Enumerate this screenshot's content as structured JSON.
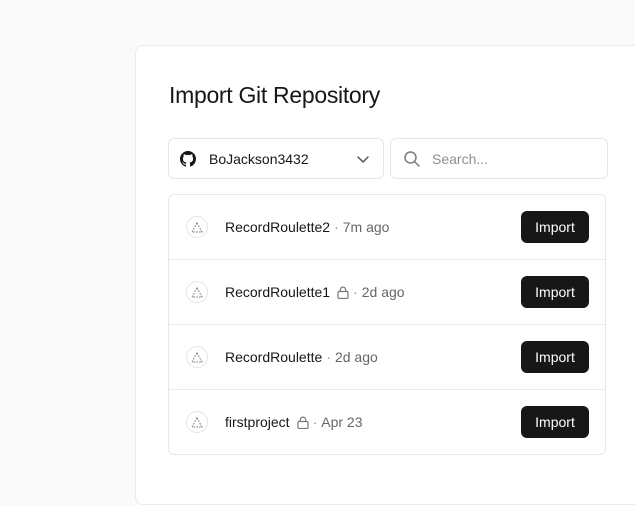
{
  "colors": {
    "page_bg": "#fafafa",
    "card_bg": "#ffffff",
    "button_bg": "#171717",
    "button_text": "#ffffff",
    "muted_text": "#666666"
  },
  "title": "Import Git Repository",
  "account": {
    "icon": "github-icon",
    "name": "BoJackson3432",
    "dropdown_icon": "chevron-down-icon"
  },
  "search": {
    "icon": "search-icon",
    "placeholder": "Search...",
    "value": ""
  },
  "repos": [
    {
      "name": "RecordRoulette2",
      "private": false,
      "separator": "·",
      "time": "7m ago",
      "action": "Import"
    },
    {
      "name": "RecordRoulette1",
      "private": true,
      "separator": "·",
      "time": "2d ago",
      "action": "Import"
    },
    {
      "name": "RecordRoulette",
      "private": false,
      "separator": "·",
      "time": "2d ago",
      "action": "Import"
    },
    {
      "name": "firstproject",
      "private": true,
      "separator": "·",
      "time": "Apr 23",
      "action": "Import"
    }
  ]
}
